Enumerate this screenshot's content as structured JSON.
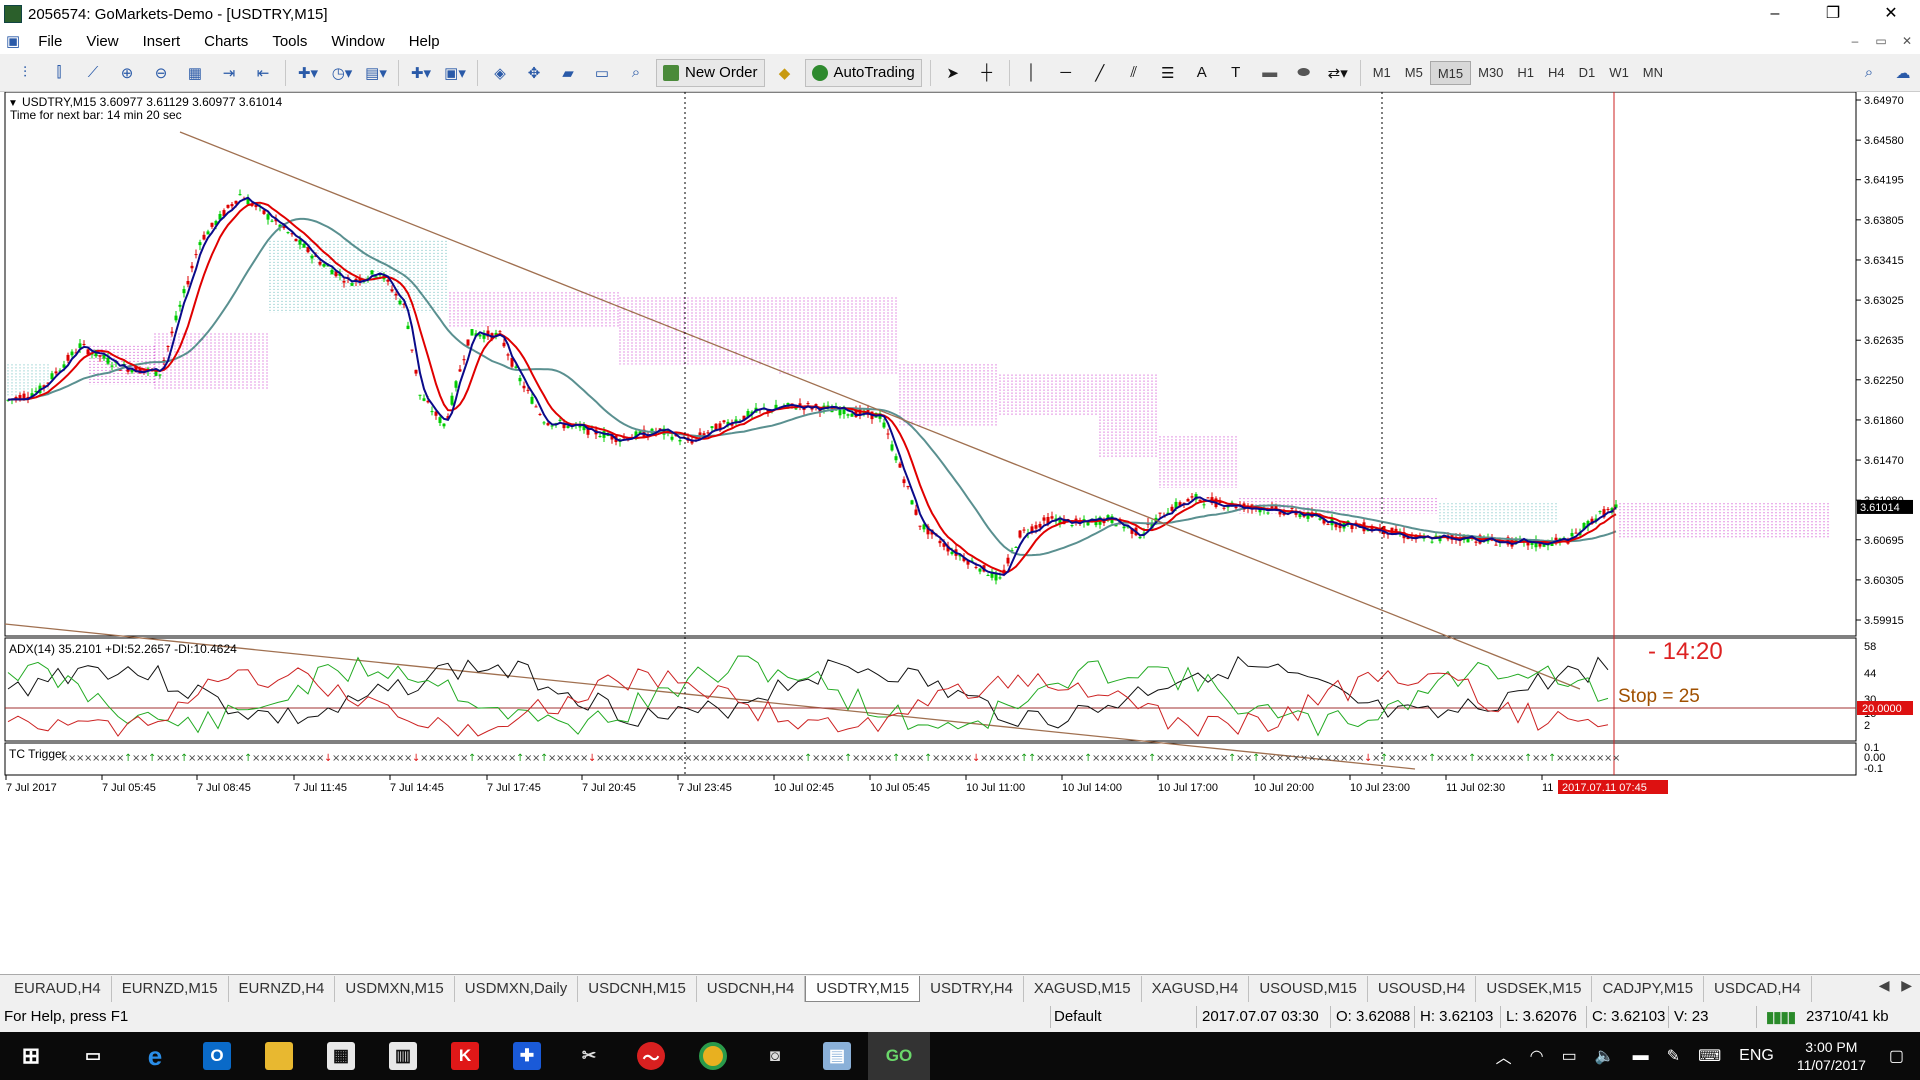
{
  "window": {
    "title": "2056574: GoMarkets-Demo - [USDTRY,M15]",
    "minimize": "–",
    "restore": "❐",
    "close": "✕"
  },
  "menu": {
    "items": [
      "File",
      "View",
      "Insert",
      "Charts",
      "Tools",
      "Window",
      "Help"
    ],
    "mdi": [
      "–",
      "▭",
      "✕"
    ]
  },
  "toolbar": {
    "new_order": "New Order",
    "autotrading": "AutoTrading",
    "timeframes": [
      "M1",
      "M5",
      "M15",
      "M30",
      "H1",
      "H4",
      "D1",
      "W1",
      "MN"
    ],
    "selected_timeframe": "M15"
  },
  "chart": {
    "header": "USDTRY,M15  3.60977 3.61129 3.60977 3.61014",
    "next_bar": "Time for next bar: 14 min 20 sec",
    "current_price": "3.61014",
    "annotation_time": "- 14:20",
    "annotation_stop": "Stop = 25",
    "price_labels": [
      "3.64970",
      "3.64580",
      "3.64195",
      "3.63805",
      "3.63415",
      "3.63025",
      "3.62635",
      "3.62250",
      "3.61860",
      "3.61470",
      "3.61080",
      "3.60695",
      "3.60305",
      "3.59915"
    ],
    "adx_header": "ADX(14) 35.2101 +DI:52.2657 -DI:10.4624",
    "adx_labels": [
      "58",
      "44",
      "30",
      "16",
      "2"
    ],
    "adx_level": "20.0000",
    "tc_header": "TC Trigger",
    "tc_labels": [
      "0.1",
      "0.00",
      "-0.1"
    ],
    "time_labels": [
      "7 Jul 2017",
      "7 Jul 05:45",
      "7 Jul 08:45",
      "7 Jul 11:45",
      "7 Jul 14:45",
      "7 Jul 17:45",
      "7 Jul 20:45",
      "7 Jul 23:45",
      "10 Jul 02:45",
      "10 Jul 05:45",
      "10 Jul 11:00",
      "10 Jul 14:00",
      "10 Jul 17:00",
      "10 Jul 20:00",
      "10 Jul 23:00",
      "11 Jul 02:30",
      "11"
    ],
    "time_highlight": "2017.07.11 07:45",
    "colors": {
      "bull": "#00cc00",
      "bear": "#dd0000",
      "fast_ma": "#0a0a8a",
      "mid_ma": "#e00000",
      "slow_ma": "#5a9090",
      "kumo_bear": "#cc33cc",
      "kumo_bull": "#66bbbb",
      "trendline": "#a07050"
    }
  },
  "tabs": {
    "items": [
      "EURAUD,H4",
      "EURNZD,M15",
      "EURNZD,H4",
      "USDMXN,M15",
      "USDMXN,Daily",
      "USDCNH,M15",
      "USDCNH,H4",
      "USDTRY,M15",
      "USDTRY,H4",
      "XAGUSD,M15",
      "XAGUSD,H4",
      "USOUSD,M15",
      "USOUSD,H4",
      "USDSEK,M15",
      "CADJPY,M15",
      "USDCAD,H4"
    ],
    "active": "USDTRY,M15"
  },
  "status": {
    "help": "For Help, press F1",
    "profile": "Default",
    "datetime": "2017.07.07 03:30",
    "open": "O: 3.62088",
    "high": "H: 3.62103",
    "low": "L: 3.62076",
    "close": "C: 3.62103",
    "volume": "V: 23",
    "traffic": "23710/41 kb"
  },
  "taskbar": {
    "lang": "ENG",
    "time": "3:00 PM",
    "date": "11/07/2017"
  }
}
